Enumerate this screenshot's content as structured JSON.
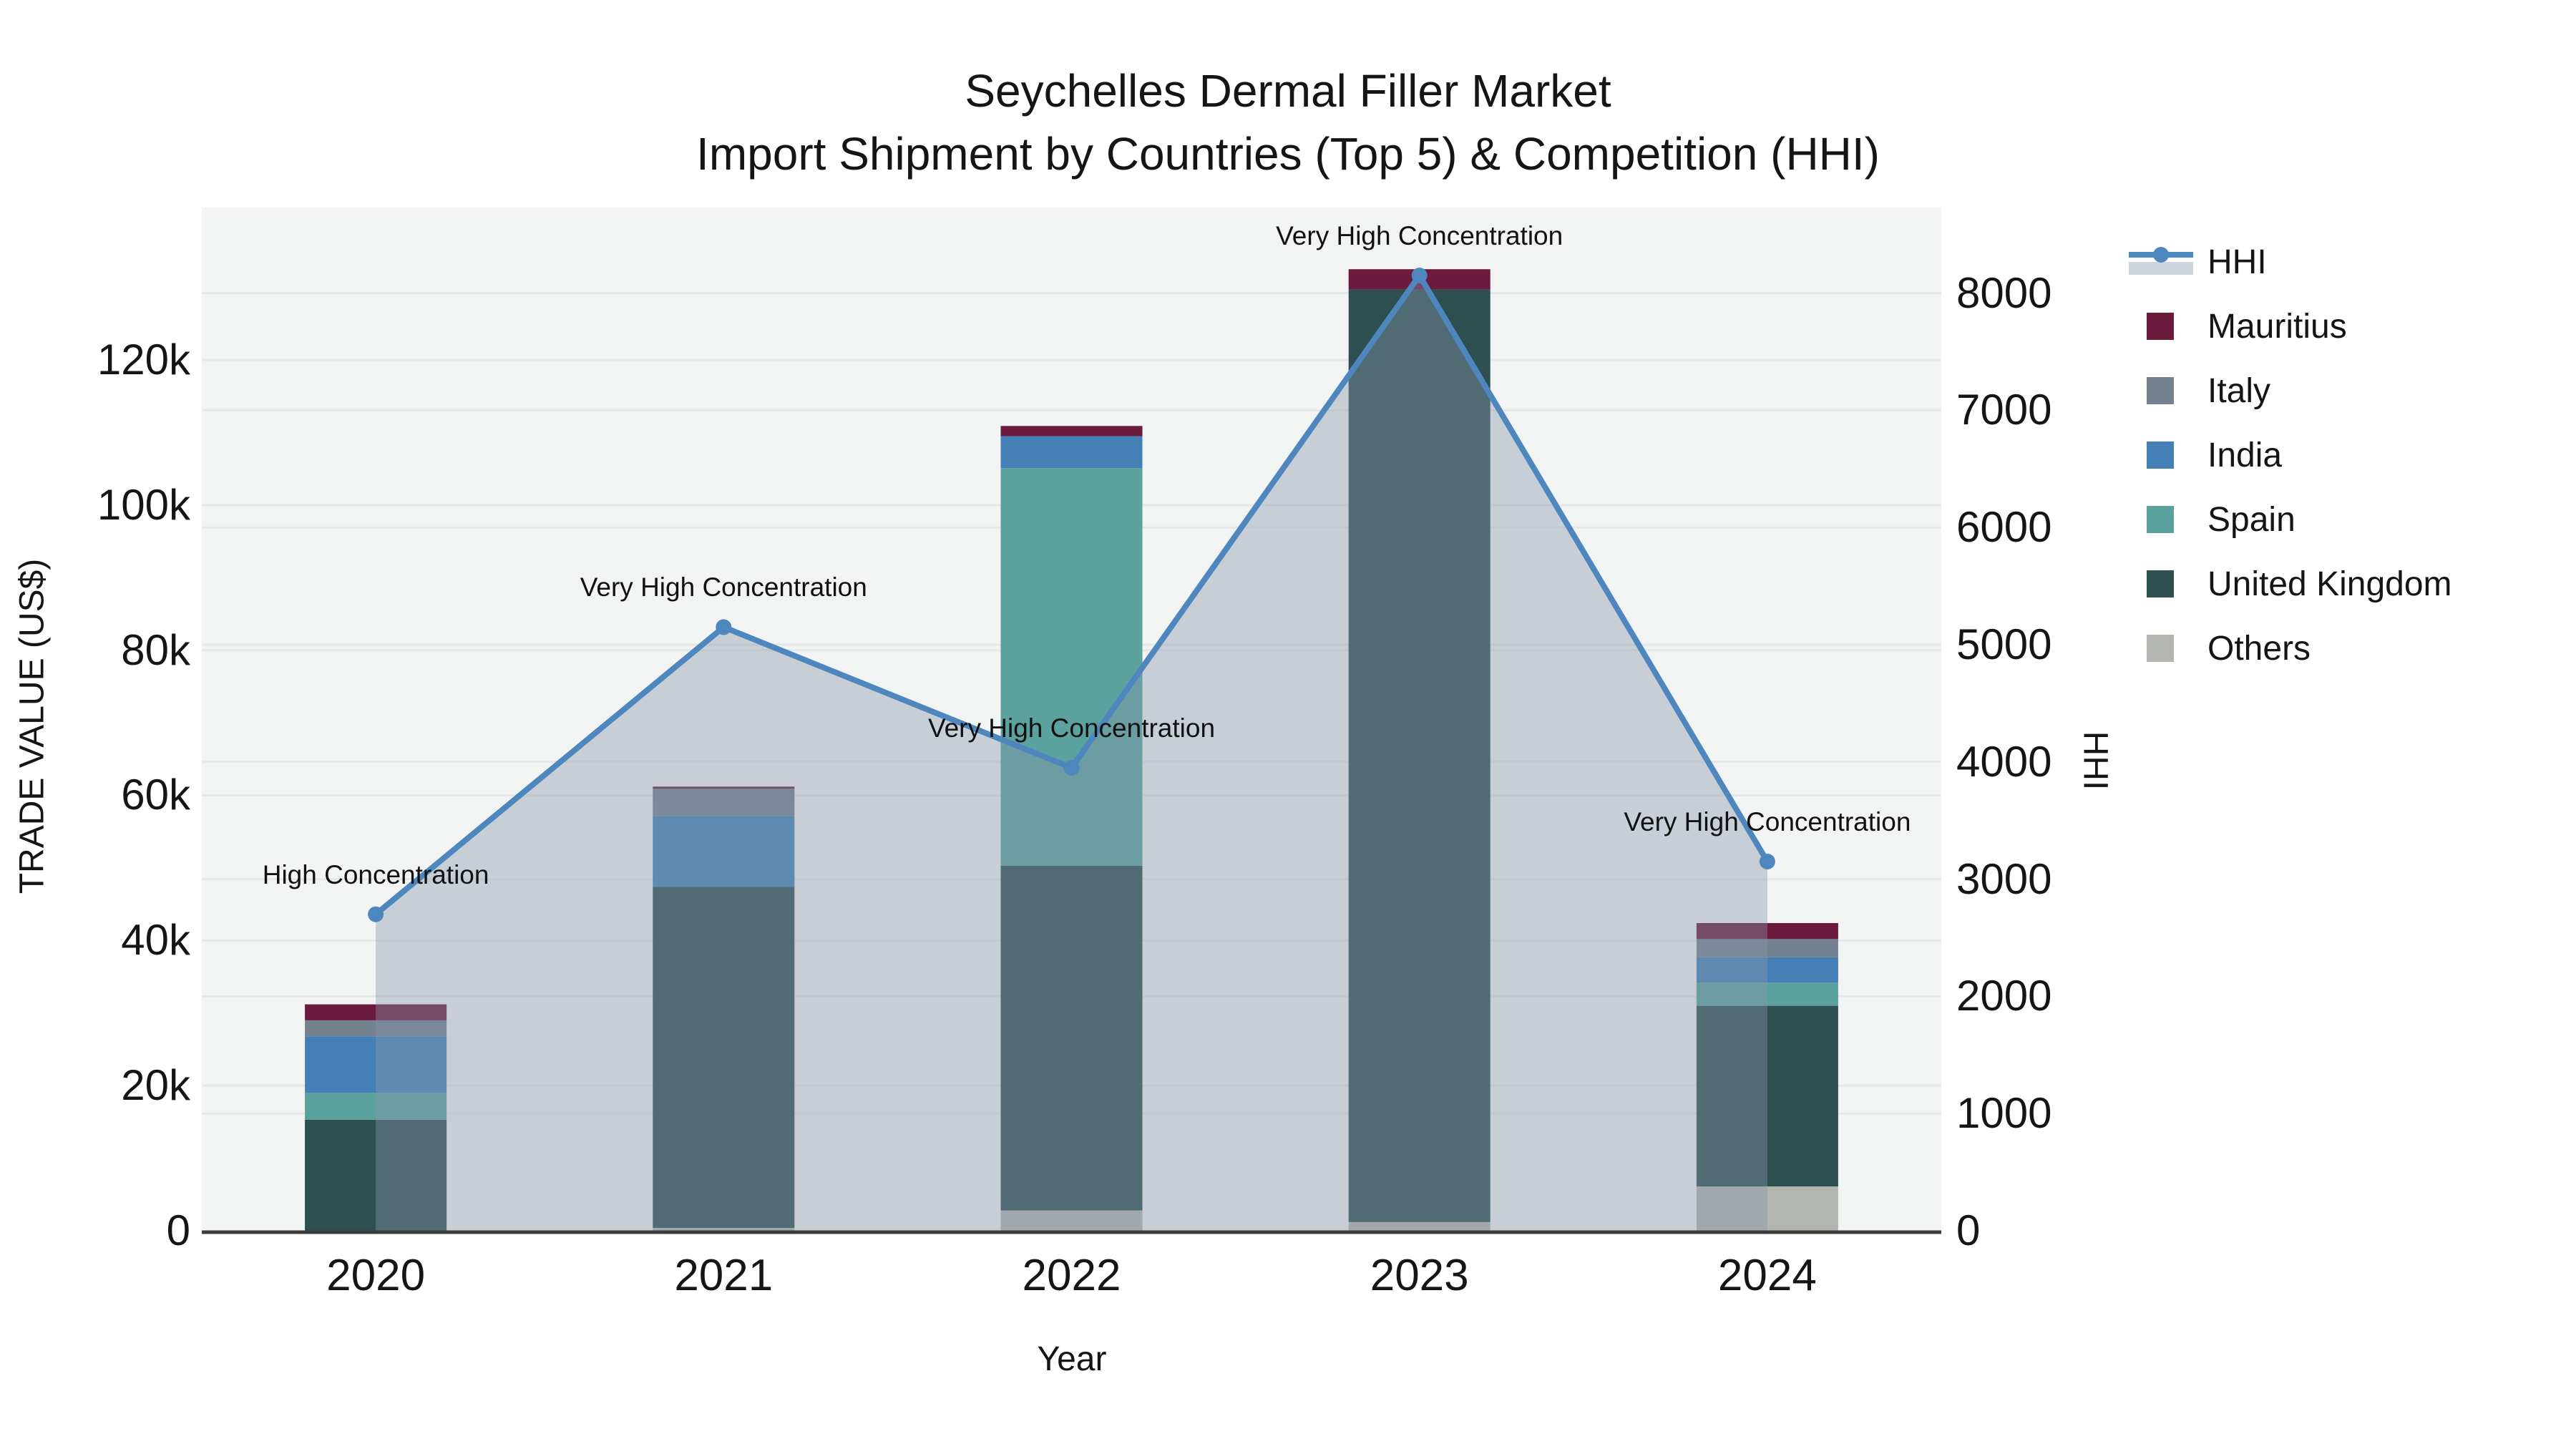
{
  "title": {
    "line1": "Seychelles Dermal Filler Market",
    "line2": "Import Shipment by Countries (Top 5) & Competition (HHI)"
  },
  "chart_data": {
    "type": "bar+line",
    "categories": [
      "2020",
      "2021",
      "2022",
      "2023",
      "2024"
    ],
    "series": [
      {
        "name": "Others",
        "color": "#B3B5B1",
        "values": [
          0,
          400,
          2800,
          1200,
          6100
        ]
      },
      {
        "name": "United Kingdom",
        "color": "#2E4F50",
        "values": [
          15300,
          47000,
          47500,
          128500,
          24900
        ]
      },
      {
        "name": "Spain",
        "color": "#5BA29E",
        "values": [
          3700,
          0,
          54800,
          0,
          3200
        ]
      },
      {
        "name": "India",
        "color": "#4480B6",
        "values": [
          7800,
          9700,
          4400,
          0,
          3500
        ]
      },
      {
        "name": "Italy",
        "color": "#74818F",
        "values": [
          2200,
          3800,
          0,
          0,
          2500
        ]
      },
      {
        "name": "Mauritius",
        "color": "#6C1A3D",
        "values": [
          2200,
          300,
          1400,
          2800,
          2200
        ]
      }
    ],
    "line": {
      "name": "HHI",
      "color": "#4E87BE",
      "area_fill": "rgba(136,150,170,0.40)",
      "values": [
        2700,
        5150,
        3950,
        8150,
        3150
      ]
    },
    "annotations": [
      "High Concentration",
      "Very High Concentration",
      "Very High Concentration",
      "Very High Concentration",
      "Very High Concentration"
    ],
    "x_axis": {
      "title": "Year"
    },
    "y_left": {
      "title": "TRADE VALUE (US$)",
      "max": 141000,
      "ticks": [
        {
          "label": "0",
          "value": 0
        },
        {
          "label": "20k",
          "value": 20000
        },
        {
          "label": "40k",
          "value": 40000
        },
        {
          "label": "60k",
          "value": 60000
        },
        {
          "label": "80k",
          "value": 80000
        },
        {
          "label": "100k",
          "value": 100000
        },
        {
          "label": "120k",
          "value": 120000
        }
      ]
    },
    "y_right": {
      "title": "HHI",
      "max": 8730,
      "ticks": [
        {
          "label": "0",
          "value": 0
        },
        {
          "label": "1000",
          "value": 1000
        },
        {
          "label": "2000",
          "value": 2000
        },
        {
          "label": "3000",
          "value": 3000
        },
        {
          "label": "4000",
          "value": 4000
        },
        {
          "label": "5000",
          "value": 5000
        },
        {
          "label": "6000",
          "value": 6000
        },
        {
          "label": "7000",
          "value": 7000
        },
        {
          "label": "8000",
          "value": 8000
        }
      ]
    },
    "legend": [
      {
        "label": "HHI",
        "type": "line",
        "color": "#4E87BE"
      },
      {
        "label": "Mauritius",
        "type": "box",
        "color": "#6C1A3D"
      },
      {
        "label": "Italy",
        "type": "box",
        "color": "#74818F"
      },
      {
        "label": "India",
        "type": "box",
        "color": "#4480B6"
      },
      {
        "label": "Spain",
        "type": "box",
        "color": "#5BA29E"
      },
      {
        "label": "United Kingdom",
        "type": "box",
        "color": "#2E4F50"
      },
      {
        "label": "Others",
        "type": "box",
        "color": "#B3B5B1"
      }
    ],
    "colors": {
      "plot_background": "#F2F3F3",
      "gridline": "#E6E8E8",
      "axis_line": "#3C3C3C"
    }
  }
}
